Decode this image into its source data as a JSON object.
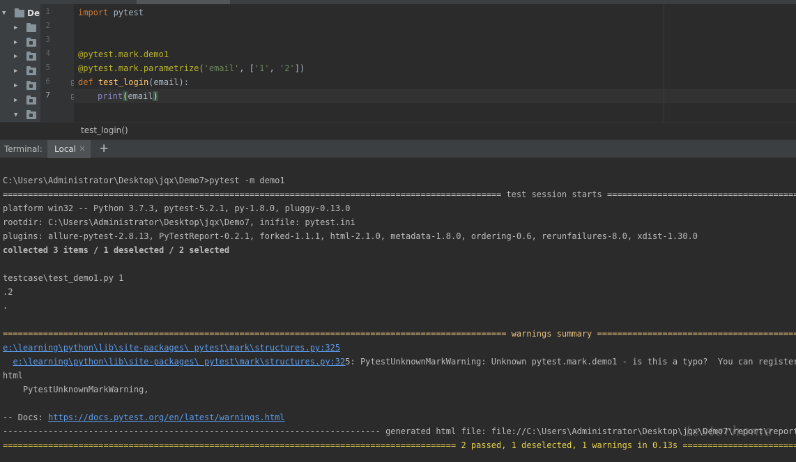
{
  "project_tree": {
    "root_label": "De"
  },
  "editor": {
    "line_numbers": [
      "1",
      "2",
      "3",
      "4",
      "5",
      "6",
      "7"
    ],
    "code": {
      "l1_kw": "import",
      "l1_rest": " pytest",
      "l4": "@pytest.mark.demo1",
      "l5_dec": "@pytest.mark.parametrize(",
      "l5_s1": "'email'",
      "l5_mid": ", [",
      "l5_s2": "'1'",
      "l5_sep": ", ",
      "l5_s3": "'2'",
      "l5_end": "])",
      "l6_kw": "def",
      "l6_fn": "test_login",
      "l6_rest": "(email):",
      "l7_print": "print",
      "l7_open": "(",
      "l7_arg": "email",
      "l7_close": ")"
    }
  },
  "breadcrumb": "test_login()",
  "terminal": {
    "title": "Terminal:",
    "tab_label": "Local",
    "close_glyph": "×",
    "add_glyph": "+",
    "lines": {
      "cmd": "C:\\Users\\Administrator\\Desktop\\jqx\\Demo7>pytest -m demo1",
      "session_start": "=================================================================================================== test session starts ===========================================================================",
      "platform": "platform win32 -- Python 3.7.3, pytest-5.2.1, py-1.8.0, pluggy-0.13.0",
      "rootdir": "rootdir: C:\\Users\\Administrator\\Desktop\\jqx\\Demo7, inifile: pytest.ini",
      "plugins": "plugins: allure-pytest-2.8.13, PyTestReport-0.2.1, forked-1.1.1, html-2.1.0, metadata-1.8.0, ordering-0.6, rerunfailures-8.0, xdist-1.30.0",
      "collected": "collected 3 items / 1 deselected / 2 selected",
      "testcase": "testcase\\test_demo1.py 1",
      "dot2": ".2",
      "dot": ".",
      "warnings_summary": "==================================================================================================== warnings summary ============================================================================",
      "link1": "e:\\learning\\python\\lib\\site-packages\\ pytest\\mark\\structures.py:325",
      "link2_prefix": "  ",
      "link2": "e:\\learning\\python\\lib\\site-packages\\ pytest\\mark\\structures.py:32",
      "link2_rest": "5: PytestUnknownMarkWarning: Unknown pytest.mark.demo1 - is this a typo?  You can register custom",
      "html": "html",
      "unknown_mark": "    PytestUnknownMarkWarning,",
      "docs_prefix": "-- Docs: ",
      "docs_link": "https://docs.pytest.org/en/latest/warnings.html",
      "generated": "--------------------------------------------------------------------------- generated html file: file://C:\\Users\\Administrator\\Desktop\\jqx\\Demo7\\report\\report",
      "summary": "========================================================================================== 2 passed, 1 deselected, 1 warnings in 0.13s ==========================================="
    },
    "watermark": "testerhome"
  },
  "colors": {
    "editor_bg": "#2b2b2b",
    "panel_bg": "#3c3f41",
    "keyword": "#cc7832",
    "decorator": "#bbb529",
    "string": "#6a8759",
    "function": "#ffc66d",
    "warning_yellow": "#e5c07b",
    "link": "#5c9ae8"
  }
}
